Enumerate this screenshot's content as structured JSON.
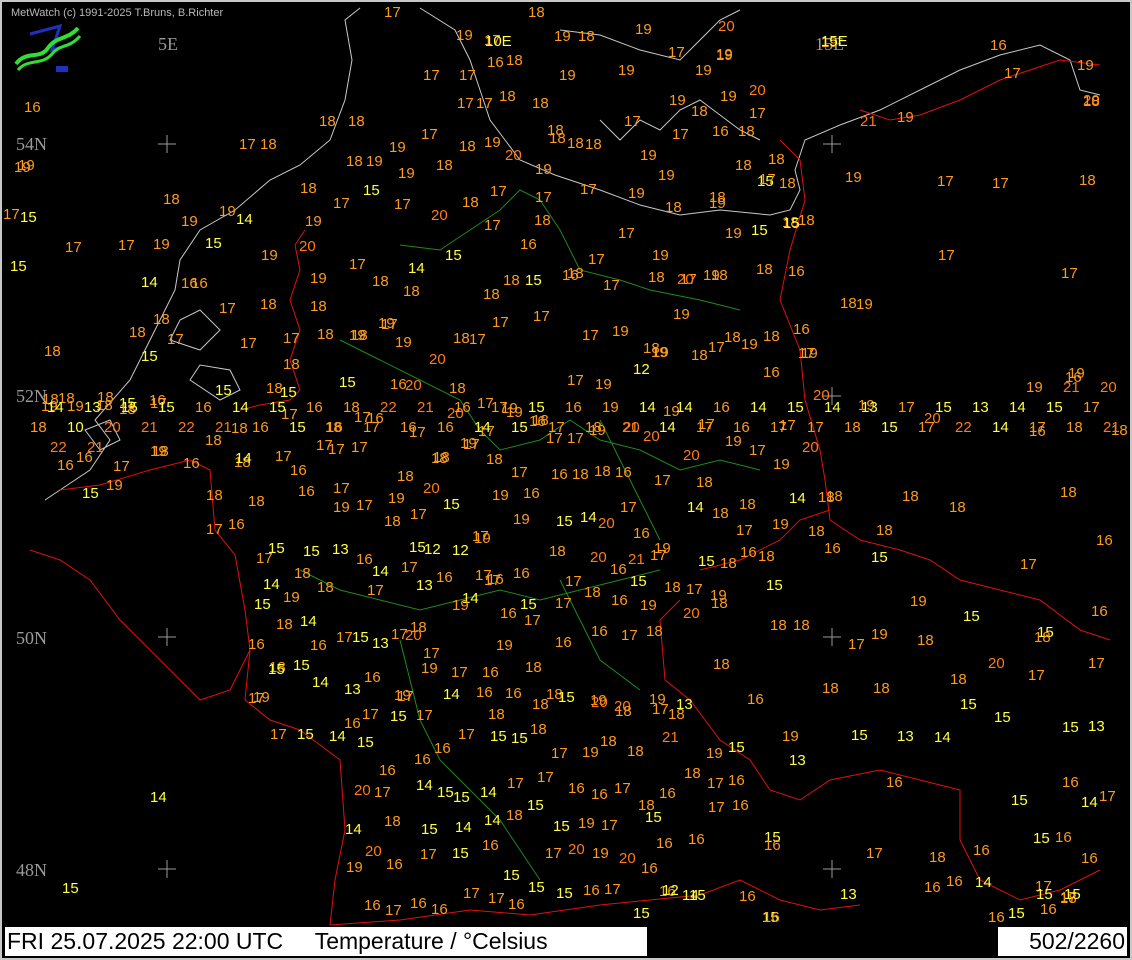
{
  "app": {
    "credit": "MetWatch  (c) 1991-2025 T.Bruns, B.Richter",
    "logo": "metwatch-logo"
  },
  "grid_labels": {
    "lon_5e": "5E",
    "lon_10e": "10E",
    "lon_15e": "15E",
    "lat_54n": "54N",
    "lat_52n": "52N",
    "lat_50n": "50N",
    "lat_48n": "48N"
  },
  "footer": {
    "title": "FRI 25.07.2025 22:00 UTC     Temperature / °Celsius",
    "count": "502/2260"
  },
  "colors": {
    "background": "#000000",
    "cool": "#ffff40",
    "warm": "#ff9a1e",
    "coastline": "#c8c8c8",
    "border": "#e01010",
    "state_border": "#1e8a1e"
  },
  "observations": [
    "17",
    "18",
    "20",
    "19",
    "17",
    "10E",
    "19",
    "18",
    "19",
    "18",
    "17",
    "19",
    "19",
    "19",
    "15E",
    "16",
    "19",
    "17",
    "17",
    "16",
    "19",
    "19",
    "19",
    "17",
    "20",
    "18",
    "17",
    "17",
    "18",
    "18",
    "19",
    "19",
    "20",
    "21",
    "19",
    "18",
    "18",
    "18",
    "17",
    "17",
    "18",
    "19",
    "18",
    "20",
    "17",
    "17",
    "16",
    "18",
    "18",
    "19",
    "19",
    "18",
    "18",
    "18",
    "19",
    "18",
    "18",
    "19",
    "17",
    "17",
    "18",
    "19",
    "18",
    "17",
    "18",
    "18",
    "19",
    "18",
    "19",
    "17",
    "19",
    "19",
    "18",
    "15",
    "18",
    "17",
    "17",
    "19",
    "19",
    "19",
    "14",
    "19",
    "17",
    "15",
    "17",
    "20",
    "18",
    "17",
    "17",
    "18",
    "19",
    "17",
    "18",
    "18",
    "15",
    "14",
    "16",
    "15",
    "19",
    "20",
    "19",
    "17",
    "18",
    "14",
    "15",
    "17",
    "16",
    "18",
    "18",
    "17",
    "17",
    "19",
    "17",
    "19",
    "19",
    "15",
    "15",
    "17",
    "17",
    "18",
    "18",
    "18",
    "16",
    "17",
    "17",
    "18",
    "18",
    "19",
    "19",
    "18",
    "18",
    "18",
    "15",
    "16",
    "17",
    "18",
    "20",
    "18",
    "18",
    "16",
    "18",
    "19",
    "19",
    "19",
    "18",
    "15",
    "15",
    "16",
    "17",
    "15",
    "18",
    "18",
    "18",
    "18",
    "17",
    "19",
    "20",
    "18",
    "17",
    "17",
    "17",
    "17",
    "19",
    "18",
    "19",
    "18",
    "18",
    "16",
    "19",
    "19",
    "16",
    "18",
    "18",
    "18",
    "18",
    "17",
    "17",
    "15",
    "15",
    "16",
    "16",
    "20",
    "18",
    "17",
    "19",
    "18",
    "17",
    "19",
    "12",
    "19",
    "19",
    "18",
    "17",
    "19",
    "16",
    "17",
    "20",
    "19",
    "20",
    "18",
    "16",
    "16",
    "17",
    "18",
    "18",
    "18",
    "18",
    "17",
    "18",
    "17",
    "17",
    "17",
    "18",
    "20",
    "17",
    "19",
    "19",
    "16",
    "17",
    "17",
    "19",
    "20",
    "20",
    "19",
    "17",
    "19",
    "17",
    "17",
    "20",
    "16",
    "15",
    "19",
    "19",
    "16",
    "18",
    "14",
    "17",
    "16",
    "17",
    "17",
    "18",
    "20",
    "18",
    "17",
    "18",
    "17",
    "16",
    "18",
    "18",
    "16",
    "17",
    "20",
    "18",
    "18",
    "19",
    "14",
    "18",
    "18",
    "18",
    "18",
    "17",
    "16",
    "18",
    "16",
    "17",
    "19",
    "17",
    "19",
    "18",
    "17",
    "15",
    "19",
    "19",
    "19",
    "16",
    "15",
    "14",
    "20",
    "17",
    "16",
    "19",
    "14",
    "18",
    "17",
    "19",
    "18",
    "18",
    "18",
    "16",
    "16",
    "17",
    "15",
    "14",
    "15",
    "13",
    "16",
    "14",
    "15",
    "12",
    "12",
    "17",
    "16",
    "16",
    "18",
    "20",
    "16",
    "21",
    "17",
    "15",
    "18",
    "16",
    "18",
    "15",
    "15",
    "17",
    "15",
    "19",
    "18",
    "18",
    "17",
    "17",
    "13",
    "16",
    "14",
    "17",
    "16",
    "15",
    "17",
    "17",
    "18",
    "16",
    "15",
    "19",
    "18",
    "17",
    "19",
    "19",
    "15",
    "15",
    "16",
    "16",
    "18",
    "18",
    "14",
    "16",
    "17",
    "15",
    "13",
    "17",
    "18",
    "17",
    "19",
    "17",
    "19",
    "17",
    "16",
    "16",
    "17",
    "18",
    "20",
    "18",
    "18",
    "18",
    "17",
    "19",
    "18",
    "18",
    "19",
    "15",
    "15",
    "14",
    "13",
    "16",
    "19",
    "20",
    "19",
    "17",
    "16",
    "16",
    "18",
    "18",
    "19",
    "20",
    "19",
    "13",
    "18",
    "16",
    "18",
    "18",
    "18",
    "20",
    "17",
    "17",
    "17",
    "17",
    "15",
    "14",
    "16",
    "17",
    "15",
    "17",
    "17",
    "14",
    "16",
    "18",
    "18",
    "15",
    "20",
    "18",
    "17",
    "18",
    "15",
    "19",
    "15",
    "13",
    "14",
    "15",
    "15",
    "15",
    "13",
    "15",
    "16",
    "16",
    "16",
    "17",
    "15",
    "15",
    "18",
    "17",
    "19",
    "18",
    "18",
    "21",
    "19",
    "13",
    "16",
    "15",
    "16",
    "14",
    "17",
    "20",
    "17",
    "14",
    "15",
    "15",
    "14",
    "17",
    "17",
    "16",
    "16",
    "17",
    "18",
    "16",
    "18",
    "17",
    "16",
    "16",
    "15",
    "15",
    "16",
    "16",
    "14",
    "18",
    "15",
    "14",
    "14",
    "18",
    "15",
    "15",
    "19",
    "17",
    "15",
    "16",
    "16",
    "17",
    "16",
    "17",
    "18",
    "16",
    "19",
    "20",
    "16",
    "17",
    "15",
    "16",
    "15",
    "17",
    "20",
    "19",
    "20",
    "16",
    "16",
    "15",
    "16",
    "16",
    "16",
    "14",
    "17",
    "18",
    "13",
    "16",
    "17",
    "16",
    "16",
    "17",
    "17",
    "16",
    "15",
    "15",
    "16",
    "17",
    "15",
    "12",
    "14",
    "15",
    "16",
    "15",
    "16",
    "17",
    "16",
    "15",
    "15",
    "15",
    "14",
    "16",
    "15",
    "17",
    "19",
    "19",
    "21",
    "20",
    "14",
    "13",
    "15",
    "15",
    "16",
    "14",
    "15",
    "16",
    "18",
    "22",
    "21",
    "16",
    "17",
    "15",
    "16",
    "19",
    "14",
    "14",
    "16",
    "14",
    "15",
    "14",
    "13",
    "17",
    "15",
    "13",
    "14",
    "15",
    "17",
    "18",
    "10",
    "20",
    "21",
    "22",
    "21",
    "16",
    "15",
    "16",
    "17",
    "16",
    "16",
    "14",
    "15",
    "17",
    "18",
    "21",
    "14",
    "17",
    "16",
    "17",
    "17",
    "18",
    "15",
    "17",
    "22",
    "14",
    "17",
    "18",
    "21",
    "22",
    "21"
  ]
}
